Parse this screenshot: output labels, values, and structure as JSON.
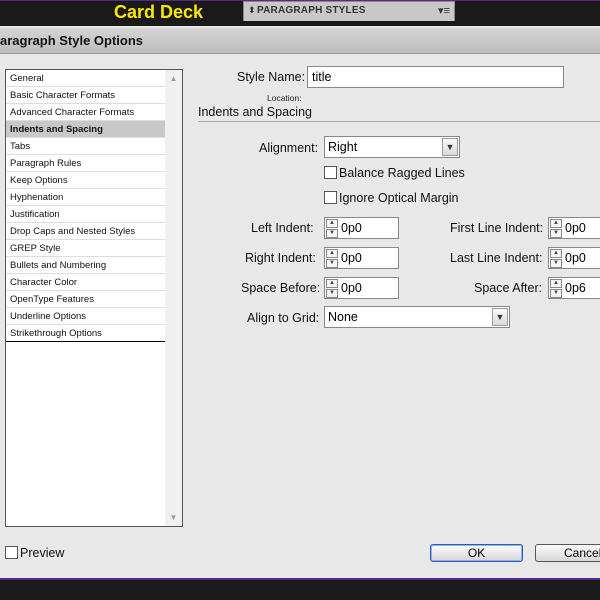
{
  "app": {
    "title": "Card Deck"
  },
  "panel_tab": {
    "label": "PARAGRAPH STYLES",
    "arrows": "⬍",
    "menu_icon": "▾≡"
  },
  "dialog": {
    "title": "aragraph Style Options"
  },
  "sidebar": {
    "items": [
      {
        "label": "General"
      },
      {
        "label": "Basic Character Formats"
      },
      {
        "label": "Advanced Character Formats"
      },
      {
        "label": "Indents and Spacing",
        "selected": true
      },
      {
        "label": "Tabs"
      },
      {
        "label": "Paragraph Rules"
      },
      {
        "label": "Keep Options"
      },
      {
        "label": "Hyphenation"
      },
      {
        "label": "Justification"
      },
      {
        "label": "Drop Caps and Nested Styles"
      },
      {
        "label": "GREP Style"
      },
      {
        "label": "Bullets and Numbering"
      },
      {
        "label": "Character Color"
      },
      {
        "label": "OpenType Features"
      },
      {
        "label": "Underline Options"
      },
      {
        "label": "Strikethrough Options"
      }
    ]
  },
  "style_name": {
    "label": "Style Name:",
    "value": "title"
  },
  "location": {
    "label": "Location:"
  },
  "section": {
    "title": "Indents and Spacing"
  },
  "alignment": {
    "label": "Alignment:",
    "value": "Right"
  },
  "balance_ragged": {
    "label": "Balance Ragged Lines",
    "checked": false
  },
  "ignore_optical": {
    "label": "Ignore Optical Margin",
    "checked": false
  },
  "left_indent": {
    "label": "Left Indent:",
    "value": "0p0"
  },
  "right_indent": {
    "label": "Right Indent:",
    "value": "0p0"
  },
  "space_before": {
    "label": "Space Before:",
    "value": "0p0"
  },
  "first_line_indent": {
    "label": "First Line Indent:",
    "value": "0p0"
  },
  "last_line_indent": {
    "label": "Last Line Indent:",
    "value": "0p0"
  },
  "space_after": {
    "label": "Space After:",
    "value": "0p6"
  },
  "align_to_grid": {
    "label": "Align to Grid:",
    "value": "None"
  },
  "preview": {
    "label": "Preview",
    "checked": false
  },
  "buttons": {
    "ok": "OK",
    "cancel": "Cancel"
  },
  "icons": {
    "spin_up": "▲",
    "spin_down": "▼",
    "dropdown": "▼",
    "scroll_up": "▲",
    "scroll_down": "▼"
  }
}
